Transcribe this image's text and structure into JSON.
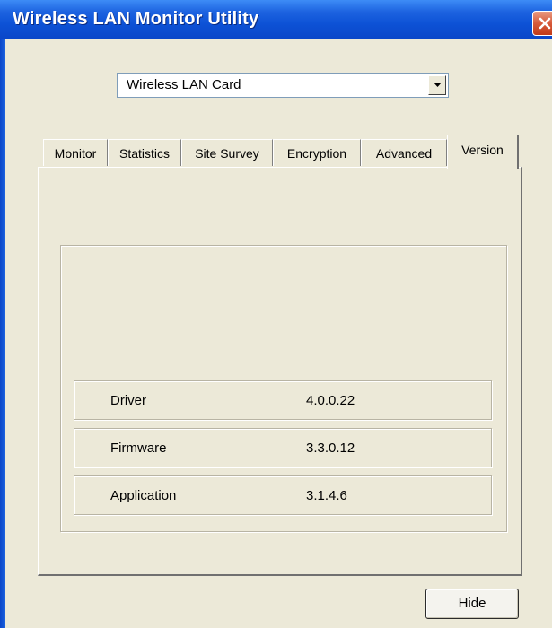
{
  "window": {
    "title": "Wireless LAN Monitor Utility",
    "close_icon": "close-icon",
    "title_bar_color": "#0d52d6"
  },
  "device_select": {
    "value": "Wireless LAN Card",
    "arrow_icon": "chevron-down-icon"
  },
  "tabs": [
    {
      "label": "Monitor",
      "active": false
    },
    {
      "label": "Statistics",
      "active": false
    },
    {
      "label": "Site Survey",
      "active": false
    },
    {
      "label": "Encryption",
      "active": false
    },
    {
      "label": "Advanced",
      "active": false
    },
    {
      "label": "Version",
      "active": true
    }
  ],
  "version_info": [
    {
      "label": "Driver",
      "value": "4.0.0.22"
    },
    {
      "label": "Firmware",
      "value": "3.3.0.12"
    },
    {
      "label": "Application",
      "value": "3.1.4.6"
    }
  ],
  "buttons": {
    "hide_label": "Hide"
  }
}
